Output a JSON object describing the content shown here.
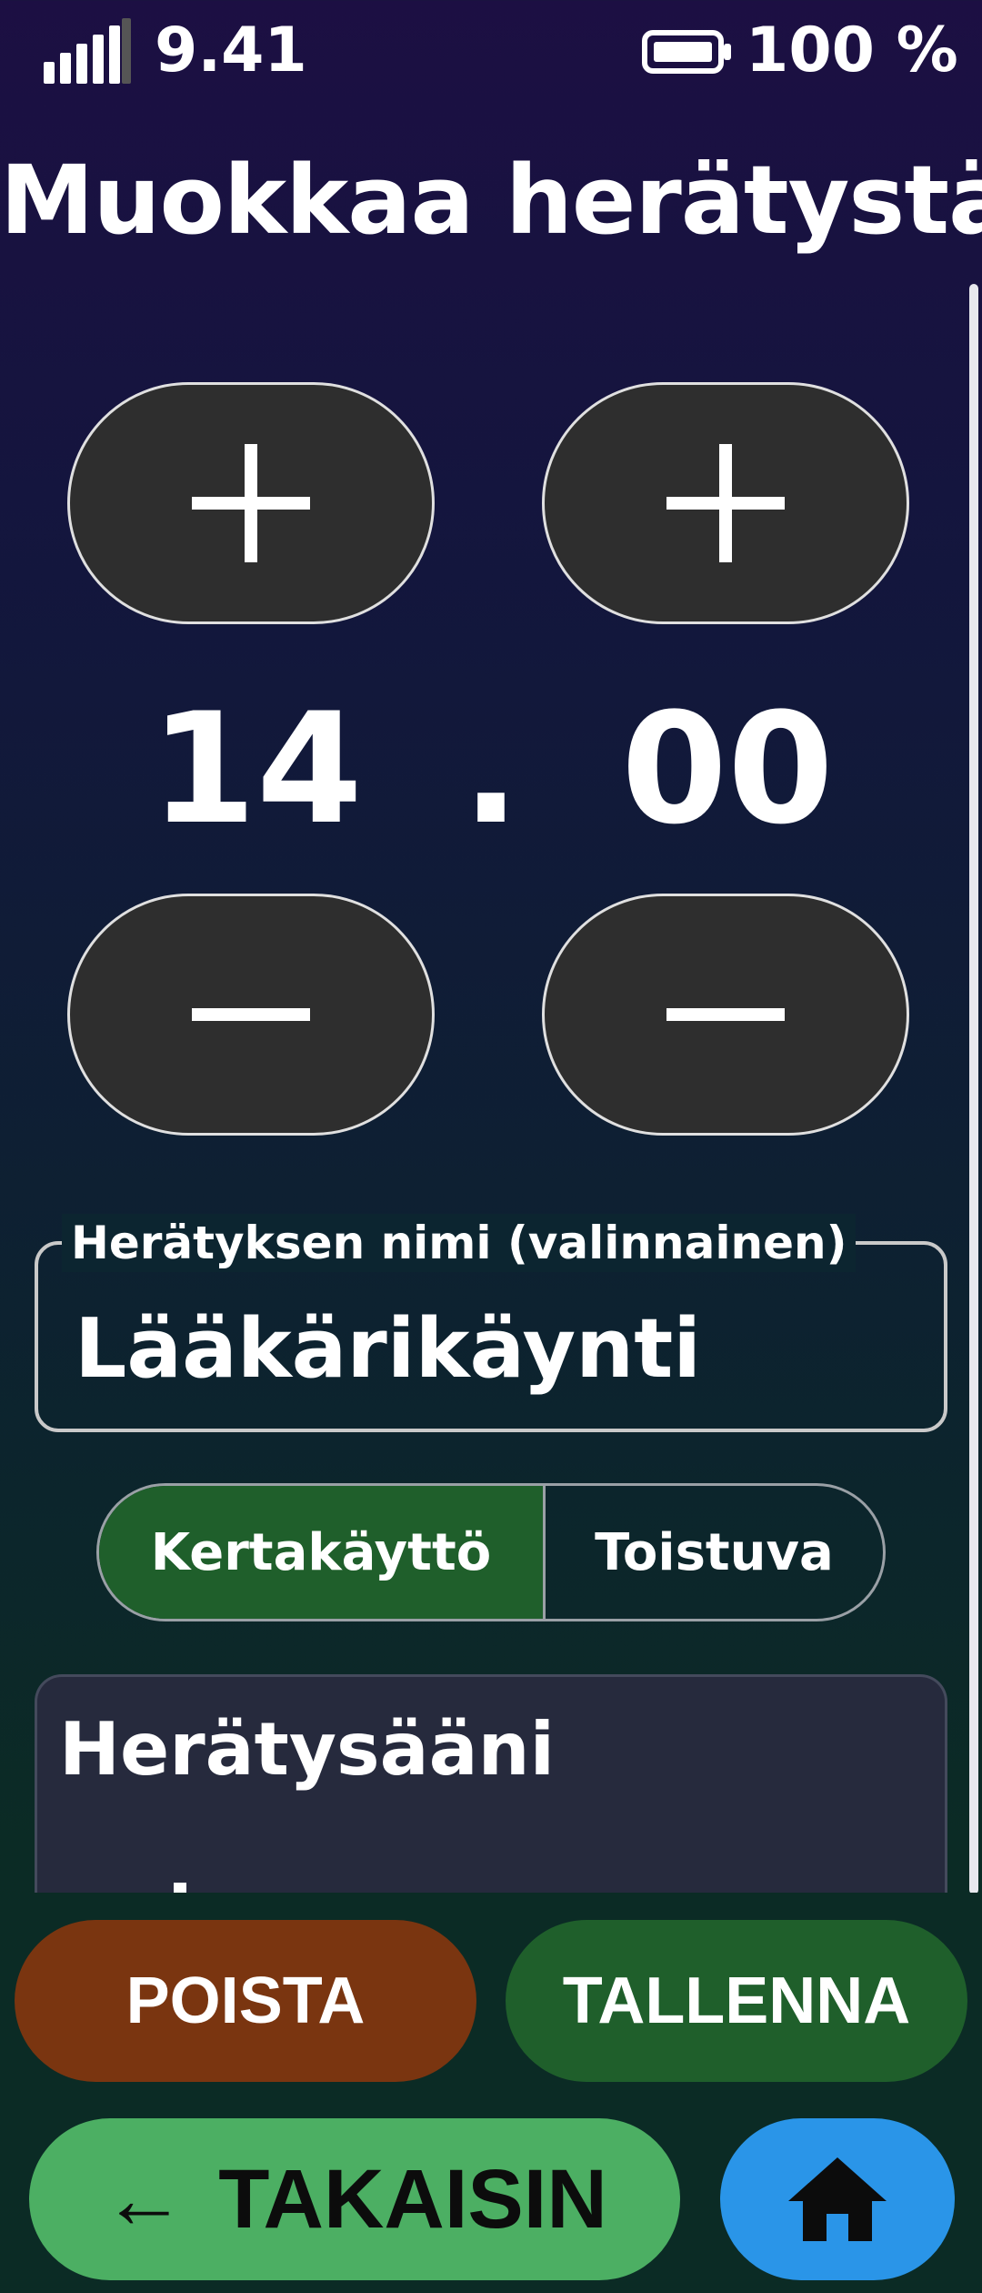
{
  "status_bar": {
    "time": "9.41",
    "battery": "100 %",
    "icons": [
      "signal-icon",
      "battery-icon"
    ]
  },
  "page": {
    "title": "Muokkaa herätystä"
  },
  "time_picker": {
    "hours": "14",
    "separator": ".",
    "minutes": "00",
    "icons": [
      "plus-icon",
      "minus-icon"
    ]
  },
  "name_field": {
    "label": "Herätyksen nimi (valinnainen)",
    "value": "Lääkärikäynti"
  },
  "repeat_mode": {
    "options": [
      "Kertakäyttö",
      "Toistuva"
    ],
    "selected": "Kertakäyttö"
  },
  "sound_section": {
    "title": "Herätysääni"
  },
  "actions": {
    "delete_label": "POISTA",
    "save_label": "TALLENNA",
    "back_label": "TAKAISIN",
    "back_arrow": "←",
    "home_icon": "home-icon"
  },
  "colors": {
    "background_top": "#1c0f43",
    "background_bottom": "#0b2b24",
    "stepper_fill": "#2e2e2e",
    "selected_segment": "#1f5f2b",
    "delete": "#7a3510",
    "save": "#1f5f2b",
    "back": "#4caf63",
    "home": "#2a95e8",
    "card": "#262a3d"
  }
}
